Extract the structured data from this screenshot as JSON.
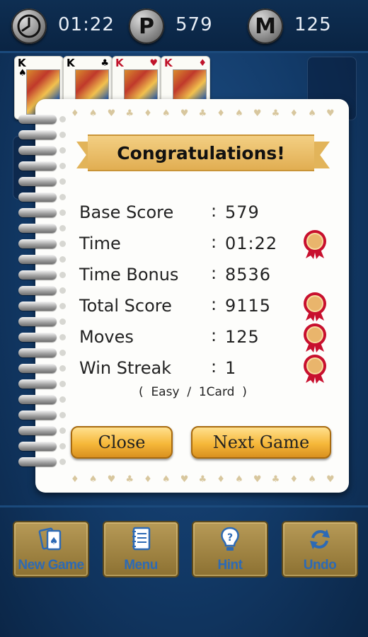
{
  "topbar": {
    "time_icon": "clock-icon",
    "time": "01:22",
    "points_letter": "P",
    "points": "579",
    "moves_letter": "M",
    "moves": "125"
  },
  "cards": [
    {
      "rank": "K",
      "suit": "♠",
      "color": "#111111"
    },
    {
      "rank": "K",
      "suit": "♣",
      "color": "#111111"
    },
    {
      "rank": "K",
      "suit": "♥",
      "color": "#c0142b"
    },
    {
      "rank": "K",
      "suit": "♦",
      "color": "#c0142b"
    }
  ],
  "dialog": {
    "title": "Congratulations!",
    "stats": [
      {
        "label": "Base Score",
        "value": "579",
        "medal": false
      },
      {
        "label": "Time",
        "value": "01:22",
        "medal": true
      },
      {
        "label": "Time Bonus",
        "value": "8536",
        "medal": false
      },
      {
        "label": "Total Score",
        "value": "9115",
        "medal": true
      },
      {
        "label": "Moves",
        "value": "125",
        "medal": true
      },
      {
        "label": "Win Streak",
        "value": "1",
        "medal": true
      }
    ],
    "colon": ":",
    "mode_text": "(  Easy  /  1Card  )",
    "close_label": "Close",
    "next_label": "Next Game",
    "border_pattern": "♦ ♠ ♥ ♣ ♦ ♠ ♥ ♣ ♦ ♠ ♥ ♣ ♦ ♠ ♥ ♣ ♦ ♠ ♥ ♣ ♦ ♠ ♥ ♣ ♦ ♠ ♥ ♣"
  },
  "toolbar": {
    "new_game": "New Game",
    "menu": "Menu",
    "hint": "Hint",
    "undo": "Undo"
  },
  "colors": {
    "background": "#123a68",
    "button_gold": "#f6b83a",
    "ribbon": "#e1ae52",
    "medal_red": "#c8102e",
    "toolbar_text": "#2d6ab5"
  }
}
